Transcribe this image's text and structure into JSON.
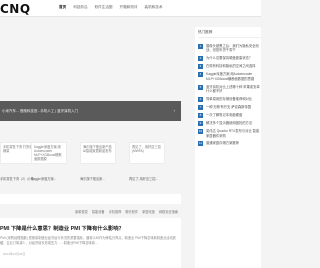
{
  "header": {
    "logo": "CNQ",
    "nav": [
      "首页",
      "科技前沿",
      "软件生活圈",
      "开箱和测评",
      "装机和技术"
    ]
  },
  "banner": {
    "label": "小米汽车... 首席科技官...手机人工 | 蓝牙耳机入门",
    "arrow": "›"
  },
  "cards": [
    {
      "thumb": "手机零售下滑 打折促销量",
      "caption": "手机零售下滑（2）价格..."
    },
    {
      "thumb": "Kaggle深度方案:用Autoencoder MLP+XGBoost横断面数据模",
      "caption": "Kaggle深度方案..."
    },
    {
      "thumb": "海尔旗下推出新产品 AI智能家居新品发布",
      "caption": "海尔旗下推出新..."
    },
    {
      "thumb": "再见了，用好这三招 (MWFA)",
      "caption": "再见了,用好这三招..."
    }
  ],
  "tags": [
    "新款首发",
    "智能设备",
    "手机推荐",
    "聊天软件",
    "家居改造",
    "网络安全指南"
  ],
  "article": {
    "title": "PMI 下降是什么意思？制造业 PMI 下降有什么影响？",
    "excerpt": "PMI (采购经理指数) 是衡量制造业经济运行状况的重要指标，通常以50作为荣枯分界点。制造业 PMI下降意味着制造业活动放缓，企业订单减少，对经济增长形成压力……制造业PMI下降意味着...",
    "meta": "2024年12月26日"
  },
  "sidebar": {
    "title": "热门推荐",
    "items": [
      "摄像头被黑之后：我们为隐私安全而战，但是年货千零千",
      "为什么总要保持硬盘健康状态？",
      "在现有科技和隐私的空间之间选择",
      "Kaggle深度方案:用Autoencoder MLP+XGBoost横断面数据的思路",
      "蓝牙耳机对比上述哪十种 苹果或安卓什么都不好",
      "简单易用的存储设备推荐和对比",
      "一种'无畅'有开支 萨克森斯帝国",
      "一次了解笔记本电脑硬盘",
      "解决多个显示器使用困扰的方法",
      "英伟达 Quadro RTX发布与对比 智能家居器件采购",
      "普通家庭存储方案推荐"
    ]
  },
  "colors": {
    "accent": "#2b6fb3",
    "banner": "#5a5a5a"
  }
}
